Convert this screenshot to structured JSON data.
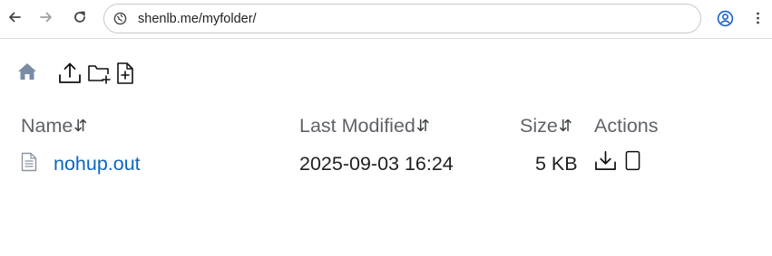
{
  "browser": {
    "url": "shenlb.me/myfolder/",
    "icons": {
      "back": "arrow-left-icon",
      "forward": "arrow-right-icon",
      "reload": "reload-icon",
      "site_info": "site-info-icon",
      "profile": "profile-icon",
      "menu": "more-vert-icon"
    }
  },
  "toolbar": {
    "icons": [
      "home-icon",
      "upload-icon",
      "new-folder-icon",
      "new-file-icon"
    ]
  },
  "table": {
    "headers": {
      "name": "Name",
      "modified": "Last Modified",
      "size": "Size",
      "actions": "Actions"
    },
    "sort_glyph": "⇵",
    "rows": [
      {
        "name": "nohup.out",
        "modified": "2025-09-03 16:24",
        "size": "5 KB",
        "actions": [
          "download-icon",
          "preview-icon"
        ]
      }
    ]
  },
  "colors": {
    "link": "#0b66c3",
    "header_text": "#5f6368",
    "home_icon": "#7a8ba6"
  }
}
